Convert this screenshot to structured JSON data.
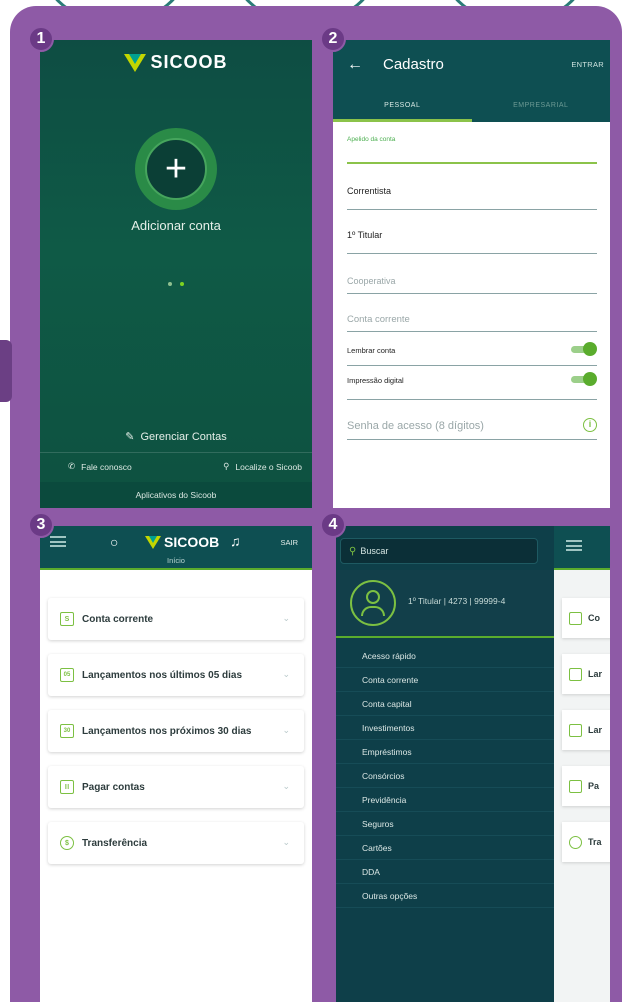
{
  "panel_numbers": [
    "1",
    "2",
    "3",
    "4"
  ],
  "panel1": {
    "brand": "SICOOB",
    "add_label": "Adicionar conta",
    "manage_label": "Gerenciar Contas",
    "contact_label": "Fale conosco",
    "locate_label": "Localize o Sicoob",
    "apps_label": "Aplicativos do Sicoob"
  },
  "panel2": {
    "title": "Cadastro",
    "enter_label": "ENTRAR",
    "tabs": [
      "PESSOAL",
      "EMPRESARIAL"
    ],
    "nickname_label": "Apelido da conta",
    "account_type": "Correntista",
    "holder": "1º Titular",
    "cooperative_placeholder": "Cooperativa",
    "checking_placeholder": "Conta corrente",
    "remember_label": "Lembrar conta",
    "fingerprint_label": "Impressão digital",
    "password_placeholder": "Senha de acesso (8 dígitos)"
  },
  "panel3": {
    "brand": "SICOOB",
    "exit_label": "SAIR",
    "subtitle": "Início",
    "cards": [
      {
        "label": "Conta corrente",
        "icon": "S"
      },
      {
        "label": "Lançamentos nos últimos 05 dias",
        "icon": "05"
      },
      {
        "label": "Lançamentos nos próximos 30 dias",
        "icon": "30"
      },
      {
        "label": "Pagar contas",
        "icon": "|||"
      },
      {
        "label": "Transferência",
        "icon": "$"
      }
    ]
  },
  "panel4": {
    "search_placeholder": "Buscar",
    "account_info": "1º Titular | 4273 | 99999-4",
    "menu": [
      "Acesso rápido",
      "Conta corrente",
      "Conta capital",
      "Investimentos",
      "Empréstimos",
      "Consórcios",
      "Previdência",
      "Seguros",
      "Cartões",
      "DDA",
      "Outras opções"
    ],
    "peek": [
      "Co",
      "Lar",
      "Lar",
      "Pa",
      "Tra"
    ]
  },
  "colors": {
    "frame": "#8e5aa6",
    "header": "#0e4f52",
    "accent": "#7cc042",
    "drawer": "#0e3f49"
  }
}
